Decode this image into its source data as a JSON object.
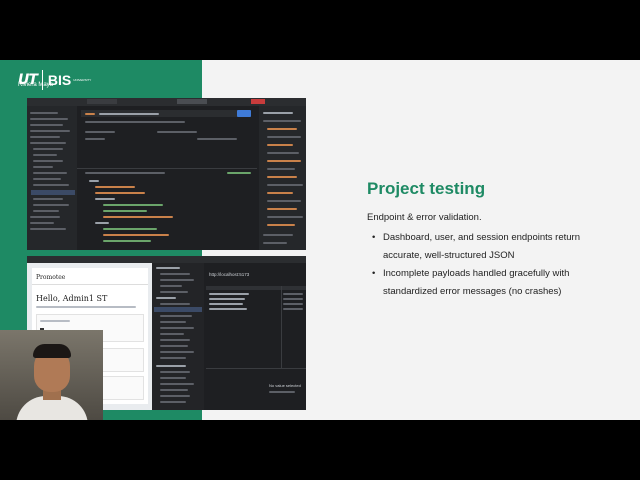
{
  "slide": {
    "title": "Project testing",
    "subtitle": "Endpoint & error validation.",
    "bullets": [
      "Dashboard, user, and session endpoints return accurate, well-structured JSON",
      "Incomplete payloads handled gracefully with standardized error messages (no crashes)"
    ],
    "colors": {
      "accent": "#1e8a64",
      "background": "#f3f3f3"
    }
  },
  "logo": {
    "mark": "UT",
    "name": "BIS",
    "location": "Riviera Maya",
    "tag": "UNIVERSITY"
  },
  "screenshot_top": {
    "icon": "api-client-screenshot",
    "send_label": "Send"
  },
  "screenshot_bottom": {
    "icon": "browser-devtools-screenshot",
    "card_title": "Promotee",
    "greeting": "Hello, Admin1 ST",
    "url": "http://localhost:5173",
    "no_value": "No value selected"
  }
}
